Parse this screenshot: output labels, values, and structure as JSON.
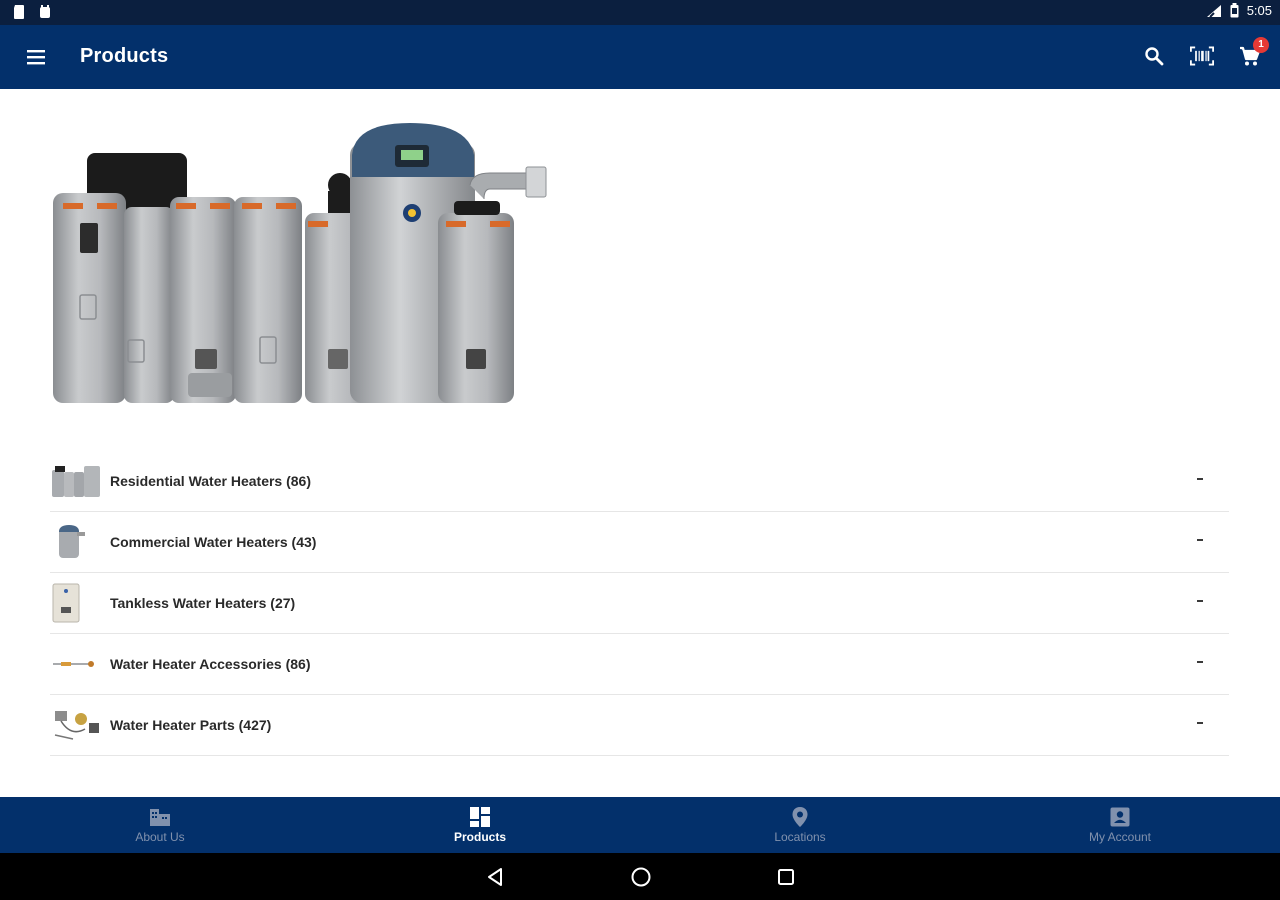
{
  "status_bar": {
    "time": "5:05"
  },
  "app_bar": {
    "title": "Products",
    "cart_count": "1"
  },
  "categories": [
    {
      "label": "Residential Water Heaters (86)",
      "thumb": "residential-heaters-thumb"
    },
    {
      "label": "Commercial Water Heaters (43)",
      "thumb": "commercial-heater-thumb"
    },
    {
      "label": "Tankless Water Heaters (27)",
      "thumb": "tankless-heater-thumb"
    },
    {
      "label": "Water Heater Accessories (86)",
      "thumb": "accessories-thumb"
    },
    {
      "label": "Water Heater Parts (427)",
      "thumb": "parts-thumb"
    }
  ],
  "bottom_nav": [
    {
      "label": "About Us",
      "icon": "building-icon",
      "active": false
    },
    {
      "label": "Products",
      "icon": "grid-icon",
      "active": true
    },
    {
      "label": "Locations",
      "icon": "location-pin-icon",
      "active": false
    },
    {
      "label": "My Account",
      "icon": "account-icon",
      "active": false
    }
  ],
  "colors": {
    "app_bar": "#03306b",
    "status_bar": "#0b1f3f",
    "badge": "#e53935",
    "nav_inactive": "#8191ad"
  }
}
